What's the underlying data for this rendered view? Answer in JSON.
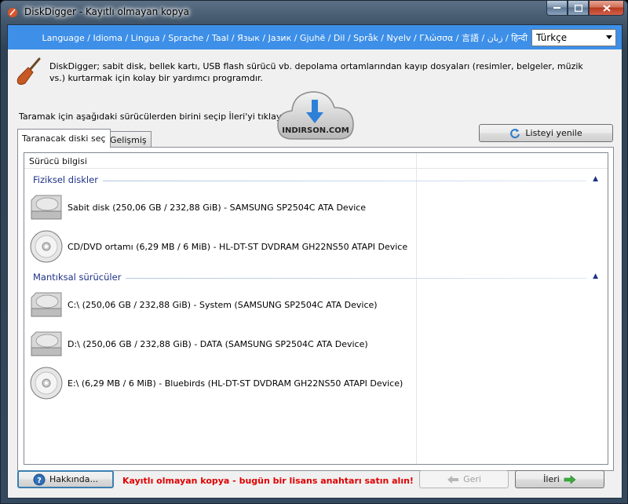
{
  "window": {
    "title": "DiskDigger - Kayıtlı olmayan kopya"
  },
  "language_bar": {
    "links": "Language / Idioma / Lingua / Sprache / Taal / Язык / Јазик / Gjuhë / Dil / Språk / Nyelv / Γλώσσα / 言語 / زبان / हिन्दी",
    "selected_language": "Türkçe"
  },
  "intro": {
    "text": "DiskDigger; sabit disk, bellek kartı, USB flash sürücü vb. depolama ortamlarından kayıp dosyaları (resimler, belgeler, müzik vs.) kurtarmak için kolay bir yardımcı programdır."
  },
  "instruction": "Taramak için aşağıdaki sürücülerden birini seçip İleri'yi tıklayın:",
  "watermark": "INDIRSON.COM",
  "refresh_button": "Listeyi yenile",
  "tabs": [
    "Taranacak diski seç",
    "Gelişmiş"
  ],
  "list": {
    "column_header": "Sürücü bilgisi",
    "groups": [
      {
        "label": "Fiziksel diskler",
        "items": [
          {
            "label": "Sabit disk (250,06 GB / 232,88 GiB) - SAMSUNG SP2504C ATA Device",
            "icon": "hard-disk-icon"
          },
          {
            "label": "CD/DVD ortamı (6,29 MB / 6 MiB) - HL-DT-ST DVDRAM GH22NS50 ATAPI Device",
            "icon": "optical-disc-icon"
          }
        ]
      },
      {
        "label": "Mantıksal sürücüler",
        "items": [
          {
            "label": "C:\\ (250,06 GB / 232,88 GiB) - System (SAMSUNG SP2504C ATA Device)",
            "icon": "hard-disk-icon"
          },
          {
            "label": "D:\\ (250,06 GB / 232,88 GiB) - DATA (SAMSUNG SP2504C ATA Device)",
            "icon": "hard-disk-icon"
          },
          {
            "label": "E:\\ (6,29 MB / 6 MiB) - Bluebirds (HL-DT-ST DVDRAM GH22NS50 ATAPI Device)",
            "icon": "optical-disc-icon"
          }
        ]
      }
    ]
  },
  "footer": {
    "about_button": "Hakkında...",
    "unregistered_notice": "Kayıtlı olmayan kopya - bugün bir lisans anahtarı satın alın!",
    "back_button": "Geri",
    "next_button": "İleri"
  },
  "colors": {
    "language_bar": "#3d8fe8",
    "group_header": "#1e3287",
    "unregistered_text": "#e00000"
  }
}
